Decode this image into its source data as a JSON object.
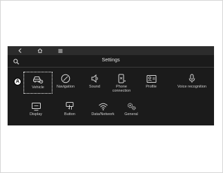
{
  "header": {
    "title": "Settings",
    "marker_label": "A"
  },
  "tiles": [
    {
      "label": "Vehicle",
      "icon": "car-gear-icon",
      "selected": true
    },
    {
      "label": "Navigation",
      "icon": "compass-icon",
      "selected": false
    },
    {
      "label": "Sound",
      "icon": "speaker-icon",
      "selected": false
    },
    {
      "label": "Phone connection",
      "icon": "phone-connection-icon",
      "selected": false
    },
    {
      "label": "Profile",
      "icon": "profile-card-icon",
      "selected": false
    },
    {
      "label": "Voice recognition",
      "icon": "microphone-icon",
      "selected": false
    },
    {
      "label": "Display",
      "icon": "monitor-icon",
      "selected": false
    },
    {
      "label": "Button",
      "icon": "button-press-icon",
      "selected": false
    },
    {
      "label": "Data/Network",
      "icon": "wifi-icon",
      "selected": false
    },
    {
      "label": "General",
      "icon": "gears-icon",
      "selected": false
    }
  ],
  "colors": {
    "screen_bg": "#1b1b1b",
    "topbar_bg": "#2c2c2c",
    "text": "#d0d0d0"
  }
}
